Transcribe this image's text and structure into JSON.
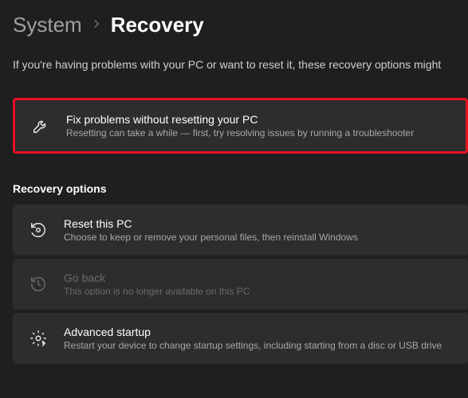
{
  "breadcrumb": {
    "parent": "System",
    "current": "Recovery"
  },
  "intro_text": "If you're having problems with your PC or want to reset it, these recovery options might",
  "highlighted_option": {
    "title": "Fix problems without resetting your PC",
    "desc": "Resetting can take a while — first, try resolving issues by running a troubleshooter"
  },
  "section_header": "Recovery options",
  "options": [
    {
      "title": "Reset this PC",
      "desc": "Choose to keep or remove your personal files, then reinstall Windows",
      "disabled": false
    },
    {
      "title": "Go back",
      "desc": "This option is no longer available on this PC",
      "disabled": true
    },
    {
      "title": "Advanced startup",
      "desc": "Restart your device to change startup settings, including starting from a disc or USB drive",
      "disabled": false
    }
  ]
}
